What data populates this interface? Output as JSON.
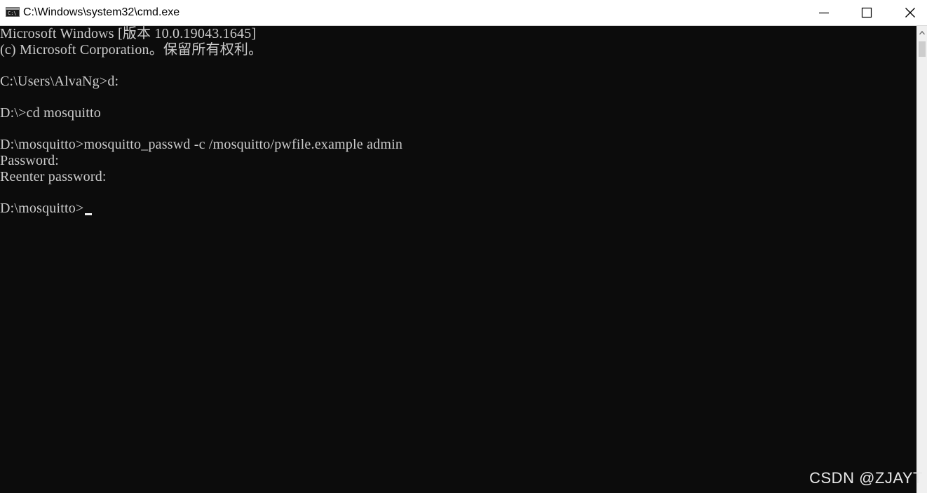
{
  "window": {
    "title": "C:\\Windows\\system32\\cmd.exe",
    "icon": "cmd-icon",
    "icon_glyph": "C:\\",
    "controls": {
      "minimize_icon": "minimize-icon",
      "maximize_icon": "maximize-icon",
      "close_icon": "close-icon"
    }
  },
  "console": {
    "background": "#0c0c0c",
    "foreground": "#cccccc",
    "lines": [
      "Microsoft Windows [版本 10.0.19043.1645]",
      "(c) Microsoft Corporation。保留所有权利。",
      "",
      "C:\\Users\\AlvaNg>d:",
      "",
      "D:\\>cd mosquitto",
      "",
      "D:\\mosquitto>mosquitto_passwd -c /mosquitto/pwfile.example admin",
      "Password:",
      "Reenter password:",
      "",
      "D:\\mosquitto>"
    ]
  },
  "watermark": "CSDN @ZJAYT"
}
